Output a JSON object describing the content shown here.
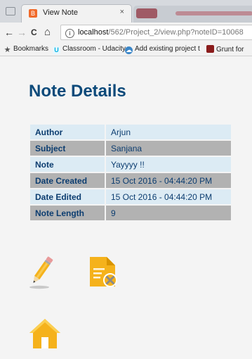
{
  "browser": {
    "active_tab": {
      "favicon_letter": "B",
      "title": "View Note",
      "close": "×"
    },
    "nav": {
      "back": "←",
      "forward": "→",
      "reload": "C",
      "home": "⌂"
    },
    "address": {
      "info_icon": "i",
      "host": "localhost",
      "path": "/562/Project_2/view.php?noteID=10068"
    },
    "bookmarks": [
      {
        "label": "Bookmarks",
        "icon": "star-icon"
      },
      {
        "label": "Classroom - Udacity",
        "icon": "udacity-icon"
      },
      {
        "label": "Add existing project t",
        "icon": "cloud-icon"
      },
      {
        "label": "Grunt for",
        "icon": "grunt-icon"
      }
    ]
  },
  "page": {
    "title": "Note Details",
    "details": [
      {
        "label": "Author",
        "value": "Arjun"
      },
      {
        "label": "Subject",
        "value": "Sanjana"
      },
      {
        "label": "Note",
        "value": "Yayyyy !!"
      },
      {
        "label": "Date Created",
        "value": "15 Oct 2016 - 04:44:20 PM"
      },
      {
        "label": "Date Edited",
        "value": "15 Oct 2016 - 04:44:20 PM"
      },
      {
        "label": "Note Length",
        "value": "9"
      }
    ],
    "actions": [
      {
        "name": "edit",
        "icon": "pencil-icon"
      },
      {
        "name": "delete",
        "icon": "delete-file-icon"
      },
      {
        "name": "home",
        "icon": "home-icon"
      }
    ],
    "colors": {
      "title": "#0d4a7a",
      "row_light": "#dcebf4",
      "row_dark": "#b2b2b2",
      "icon_orange": "#f5b21b"
    }
  }
}
